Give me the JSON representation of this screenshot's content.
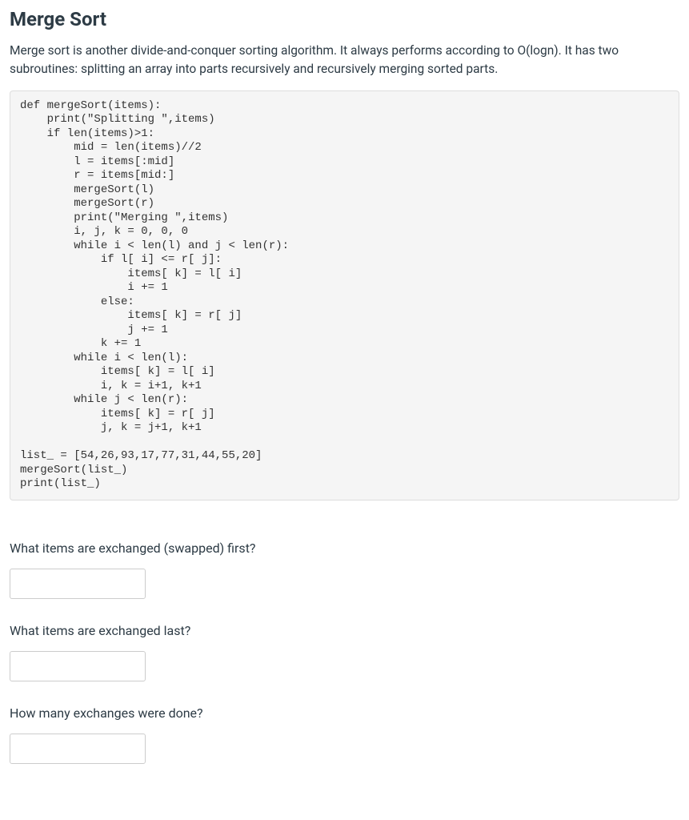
{
  "title": "Merge Sort",
  "intro": "Merge sort is another divide-and-conquer sorting algorithm. It always performs according to O(logn). It has two subroutines: splitting an array into parts recursively and recursively merging sorted parts.",
  "code": "def mergeSort(items):\n    print(\"Splitting \",items)\n    if len(items)>1:\n        mid = len(items)//2\n        l = items[:mid]\n        r = items[mid:]\n        mergeSort(l)\n        mergeSort(r)\n        print(\"Merging \",items)\n        i, j, k = 0, 0, 0\n        while i < len(l) and j < len(r):\n            if l[ i] <= r[ j]:\n                items[ k] = l[ i]\n                i += 1\n            else:\n                items[ k] = r[ j]\n                j += 1\n            k += 1\n        while i < len(l):\n            items[ k] = l[ i]\n            i, k = i+1, k+1\n        while j < len(r):\n            items[ k] = r[ j]\n            j, k = j+1, k+1\n\nlist_ = [54,26,93,17,77,31,44,55,20]\nmergeSort(list_)\nprint(list_)",
  "questions": {
    "q1": "What items are exchanged (swapped) first?",
    "q2": "What items are exchanged last?",
    "q3": "How many exchanges were done?"
  },
  "answers": {
    "a1": "",
    "a2": "",
    "a3": ""
  }
}
